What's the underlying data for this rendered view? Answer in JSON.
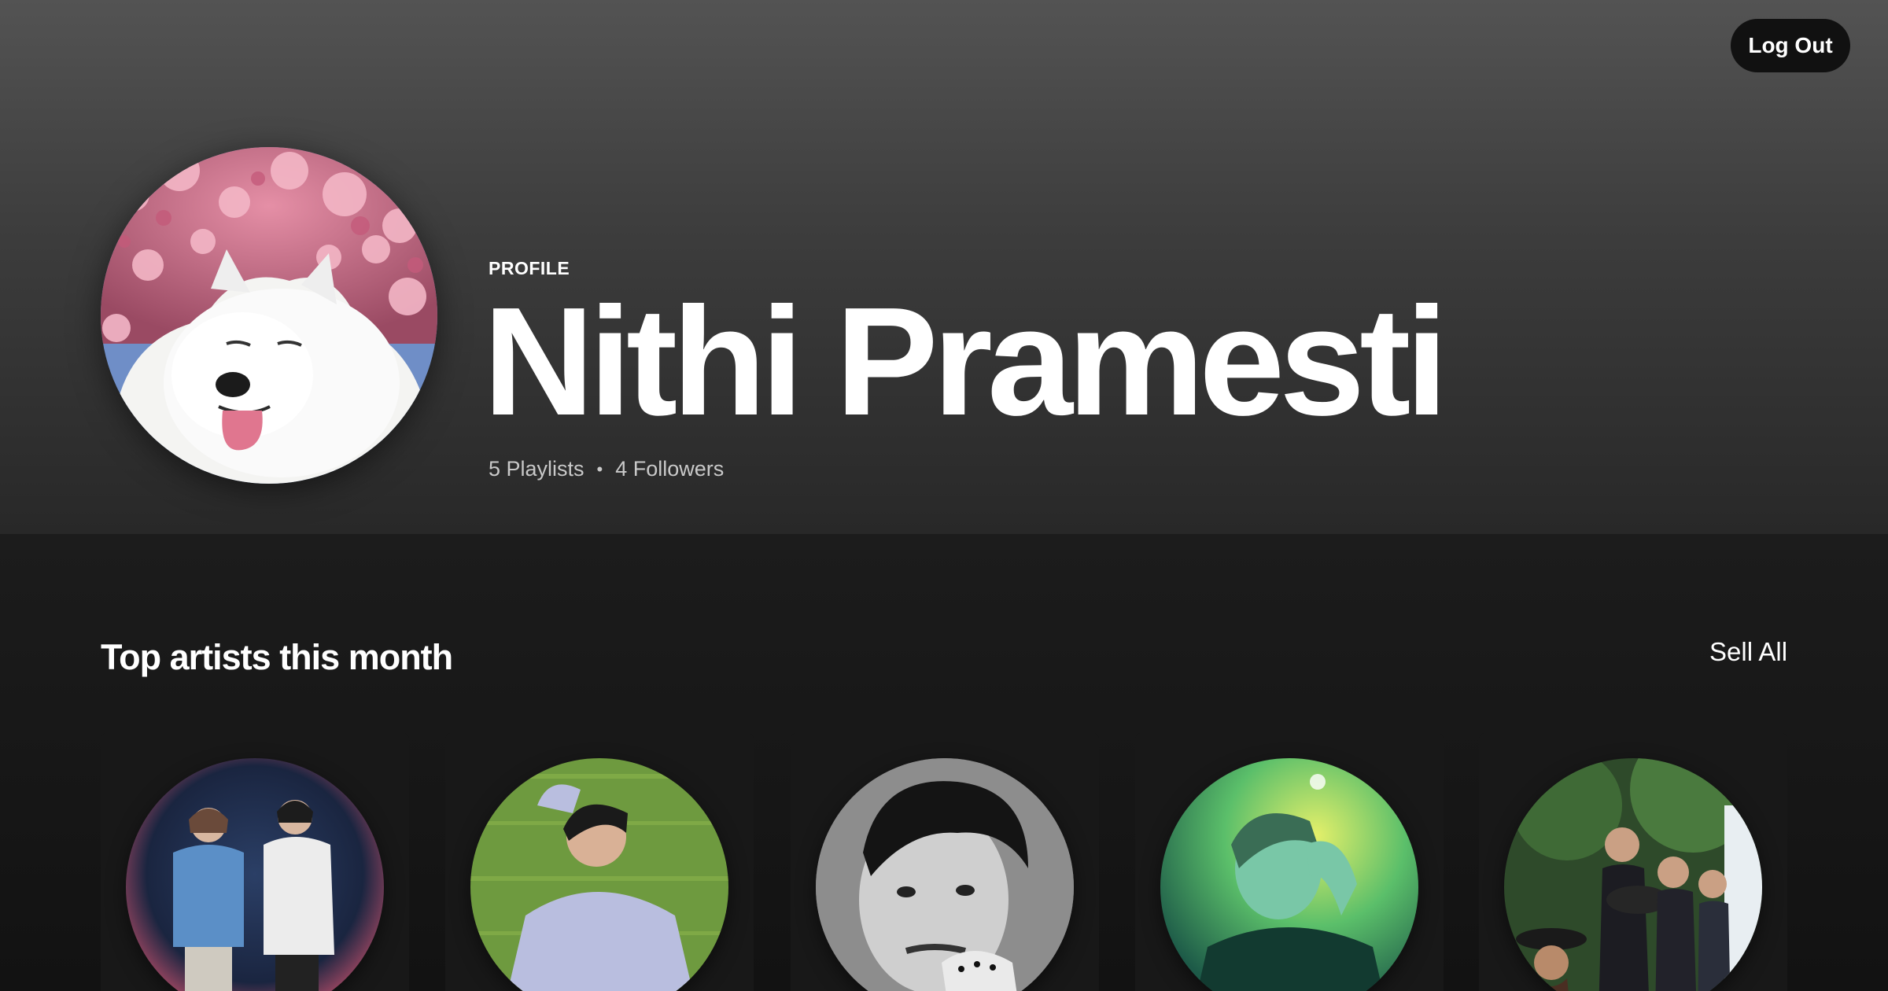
{
  "header": {
    "logout_label": "Log Out",
    "profile_type": "PROFILE",
    "display_name": "Nithi Pramesti",
    "playlists": "5 Playlists",
    "separator": "•",
    "followers": "4 Followers"
  },
  "top_artists": {
    "title": "Top artists this month",
    "see_all_label": "Sell All"
  },
  "icons": {
    "avatar": "samoyed-dog-photo",
    "artists": [
      "artist-duo-photo",
      "artist-hoodie-photo",
      "artist-bw-portrait-photo",
      "artist-green-portrait-photo",
      "artist-band-photo"
    ]
  }
}
